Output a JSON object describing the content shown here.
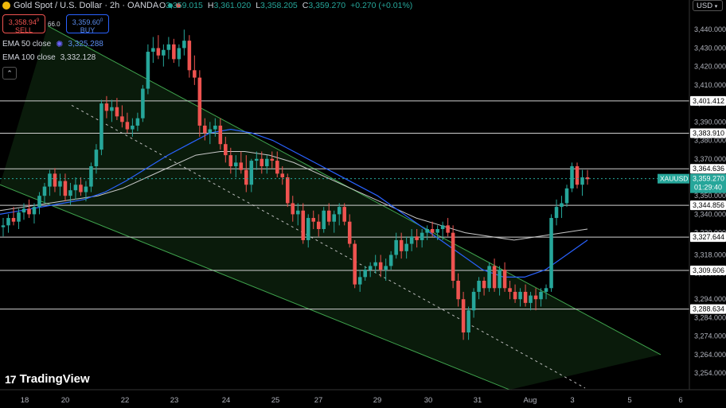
{
  "header": {
    "symbol": "Gold Spot / U.S. Dollar · 2h · OANDA",
    "ohlc": [
      {
        "label": "O",
        "value": "3,359.015"
      },
      {
        "label": "H",
        "value": "3,361.020"
      },
      {
        "label": "L",
        "value": "3,358.205"
      },
      {
        "label": "C",
        "value": "3,359.270"
      },
      {
        "label": "",
        "value": "+0.270 (+0.01%)"
      }
    ]
  },
  "trade": {
    "sell_price": "3,358.94",
    "sell_sup": "9",
    "sell_label": "SELL",
    "spread": "66.0",
    "buy_price": "3,359.60",
    "buy_sup": "0",
    "buy_label": "BUY"
  },
  "indicators": {
    "ema50_label": "EMA 50 close",
    "ema50_value": "3,325.288",
    "ema100_label": "EMA 100 close",
    "ema100_value": "3,332.128"
  },
  "currency": "USD",
  "branding": "TradingView",
  "colors": {
    "up": "#26a69a",
    "down": "#ef5350",
    "ema50": "#2962ff",
    "ema100": "#c8c8c8",
    "channel": "#3fa34d",
    "channel_fill": "rgba(46,125,50,0.22)",
    "hline": "#cfcfcf",
    "last_price_bg": "#26a69a"
  },
  "chart_data": {
    "type": "candlestick",
    "title": "Gold Spot / U.S. Dollar · 2h · OANDA",
    "ylim": [
      3245,
      3450
    ],
    "y_ticks": [
      3440,
      3430,
      3420,
      3410,
      3400,
      3390,
      3380,
      3370,
      3360,
      3350,
      3340,
      3330,
      3318,
      3308,
      3294,
      3284,
      3274,
      3264,
      3254
    ],
    "x_ticks": [
      "18",
      "20",
      "22",
      "23",
      "24",
      "25",
      "27",
      "29",
      "30",
      "31",
      "Aug",
      "3",
      "5",
      "6"
    ],
    "horizontal_levels": [
      "3,401.412",
      "3,383.910",
      "3,364.636",
      "3,344.856",
      "3,327.644",
      "3,309.606",
      "3,288.634"
    ],
    "last_price": {
      "symbol": "XAUUSD",
      "value": "3,359.270",
      "countdown": "01:29:40"
    },
    "candles": [
      [
        3333,
        3338,
        3328,
        3334
      ],
      [
        3334,
        3340,
        3330,
        3338
      ],
      [
        3338,
        3344,
        3334,
        3336
      ],
      [
        3336,
        3343,
        3332,
        3341
      ],
      [
        3341,
        3346,
        3337,
        3343
      ],
      [
        3343,
        3348,
        3338,
        3340
      ],
      [
        3340,
        3346,
        3335,
        3344
      ],
      [
        3344,
        3352,
        3340,
        3350
      ],
      [
        3350,
        3357,
        3346,
        3355
      ],
      [
        3355,
        3364,
        3350,
        3362
      ],
      [
        3362,
        3365,
        3352,
        3355
      ],
      [
        3355,
        3362,
        3350,
        3358
      ],
      [
        3358,
        3362,
        3347,
        3350
      ],
      [
        3350,
        3357,
        3345,
        3353
      ],
      [
        3353,
        3360,
        3348,
        3356
      ],
      [
        3356,
        3360,
        3350,
        3352
      ],
      [
        3352,
        3358,
        3347,
        3355
      ],
      [
        3355,
        3368,
        3352,
        3366
      ],
      [
        3366,
        3378,
        3362,
        3375
      ],
      [
        3375,
        3402,
        3372,
        3400
      ],
      [
        3400,
        3404,
        3392,
        3396
      ],
      [
        3396,
        3402,
        3390,
        3398
      ],
      [
        3398,
        3403,
        3391,
        3393
      ],
      [
        3393,
        3399,
        3387,
        3390
      ],
      [
        3390,
        3395,
        3384,
        3386
      ],
      [
        3386,
        3392,
        3382,
        3388
      ],
      [
        3388,
        3395,
        3385,
        3392
      ],
      [
        3392,
        3410,
        3390,
        3408
      ],
      [
        3408,
        3432,
        3405,
        3428
      ],
      [
        3428,
        3436,
        3422,
        3430
      ],
      [
        3430,
        3437,
        3424,
        3426
      ],
      [
        3426,
        3432,
        3420,
        3429
      ],
      [
        3429,
        3436,
        3424,
        3432
      ],
      [
        3432,
        3435,
        3422,
        3424
      ],
      [
        3424,
        3432,
        3420,
        3430
      ],
      [
        3430,
        3440,
        3426,
        3434
      ],
      [
        3434,
        3437,
        3414,
        3418
      ],
      [
        3418,
        3426,
        3410,
        3414
      ],
      [
        3414,
        3418,
        3382,
        3388
      ],
      [
        3388,
        3392,
        3380,
        3384
      ],
      [
        3384,
        3390,
        3378,
        3386
      ],
      [
        3386,
        3392,
        3382,
        3388
      ],
      [
        3388,
        3392,
        3375,
        3378
      ],
      [
        3378,
        3382,
        3368,
        3372
      ],
      [
        3372,
        3376,
        3362,
        3366
      ],
      [
        3366,
        3372,
        3360,
        3368
      ],
      [
        3368,
        3374,
        3362,
        3364
      ],
      [
        3364,
        3372,
        3352,
        3356
      ],
      [
        3356,
        3370,
        3352,
        3369
      ],
      [
        3369,
        3374,
        3364,
        3370
      ],
      [
        3370,
        3374,
        3362,
        3366
      ],
      [
        3366,
        3372,
        3362,
        3370
      ],
      [
        3370,
        3374,
        3365,
        3369
      ],
      [
        3369,
        3374,
        3360,
        3362
      ],
      [
        3362,
        3366,
        3356,
        3360
      ],
      [
        3360,
        3362,
        3344,
        3346
      ],
      [
        3346,
        3350,
        3336,
        3340
      ],
      [
        3340,
        3346,
        3334,
        3342
      ],
      [
        3342,
        3346,
        3324,
        3326
      ],
      [
        3326,
        3340,
        3322,
        3338
      ],
      [
        3338,
        3342,
        3332,
        3336
      ],
      [
        3336,
        3340,
        3328,
        3332
      ],
      [
        3332,
        3344,
        3330,
        3342
      ],
      [
        3342,
        3346,
        3334,
        3336
      ],
      [
        3336,
        3342,
        3330,
        3340
      ],
      [
        3340,
        3346,
        3334,
        3344
      ],
      [
        3344,
        3346,
        3334,
        3336
      ],
      [
        3336,
        3340,
        3322,
        3324
      ],
      [
        3324,
        3326,
        3300,
        3302
      ],
      [
        3302,
        3310,
        3298,
        3306
      ],
      [
        3306,
        3312,
        3304,
        3310
      ],
      [
        3310,
        3314,
        3306,
        3312
      ],
      [
        3312,
        3318,
        3308,
        3314
      ],
      [
        3314,
        3318,
        3306,
        3310
      ],
      [
        3310,
        3316,
        3304,
        3312
      ],
      [
        3312,
        3320,
        3310,
        3318
      ],
      [
        3318,
        3330,
        3316,
        3326
      ],
      [
        3326,
        3330,
        3316,
        3320
      ],
      [
        3320,
        3328,
        3316,
        3324
      ],
      [
        3324,
        3332,
        3320,
        3328
      ],
      [
        3328,
        3332,
        3322,
        3326
      ],
      [
        3326,
        3332,
        3322,
        3330
      ],
      [
        3330,
        3334,
        3326,
        3332
      ],
      [
        3332,
        3336,
        3328,
        3330
      ],
      [
        3330,
        3334,
        3326,
        3332
      ],
      [
        3332,
        3336,
        3326,
        3334
      ],
      [
        3334,
        3338,
        3328,
        3330
      ],
      [
        3330,
        3334,
        3300,
        3304
      ],
      [
        3304,
        3308,
        3290,
        3294
      ],
      [
        3294,
        3298,
        3272,
        3276
      ],
      [
        3276,
        3290,
        3272,
        3288
      ],
      [
        3288,
        3300,
        3284,
        3298
      ],
      [
        3298,
        3306,
        3294,
        3304
      ],
      [
        3304,
        3306,
        3296,
        3300
      ],
      [
        3300,
        3314,
        3298,
        3312
      ],
      [
        3312,
        3316,
        3298,
        3300
      ],
      [
        3300,
        3312,
        3296,
        3310
      ],
      [
        3310,
        3314,
        3298,
        3300
      ],
      [
        3300,
        3304,
        3294,
        3298
      ],
      [
        3298,
        3302,
        3292,
        3294
      ],
      [
        3294,
        3300,
        3290,
        3298
      ],
      [
        3298,
        3302,
        3290,
        3292
      ],
      [
        3292,
        3298,
        3288,
        3296
      ],
      [
        3296,
        3300,
        3288,
        3294
      ],
      [
        3294,
        3300,
        3290,
        3298
      ],
      [
        3298,
        3302,
        3294,
        3300
      ],
      [
        3300,
        3340,
        3298,
        3338
      ],
      [
        3338,
        3348,
        3334,
        3344
      ],
      [
        3344,
        3350,
        3338,
        3346
      ],
      [
        3346,
        3356,
        3344,
        3354
      ],
      [
        3354,
        3368,
        3352,
        3366
      ],
      [
        3366,
        3368,
        3354,
        3356
      ],
      [
        3356,
        3364,
        3350,
        3360
      ],
      [
        3360,
        3364,
        3356,
        3359
      ]
    ],
    "ema50": [
      3340,
      3342,
      3344,
      3346,
      3348,
      3352,
      3358,
      3365,
      3372,
      3378,
      3384,
      3386,
      3384,
      3380,
      3374,
      3368,
      3362,
      3356,
      3350,
      3342,
      3334,
      3326,
      3318,
      3310,
      3306,
      3306,
      3310,
      3318,
      3326
    ],
    "ema100": [
      3342,
      3344,
      3346,
      3348,
      3350,
      3354,
      3360,
      3366,
      3372,
      3374,
      3374,
      3372,
      3368,
      3362,
      3356,
      3350,
      3344,
      3338,
      3334,
      3330,
      3328,
      3326,
      3328,
      3330,
      3332
    ],
    "channel": {
      "upper_start": [
        3442,
        0.02
      ],
      "upper_end": [
        3264,
        0.91
      ],
      "lower_start": [
        3356,
        0.0
      ],
      "lower_end": [
        3230,
        0.7
      ]
    }
  }
}
